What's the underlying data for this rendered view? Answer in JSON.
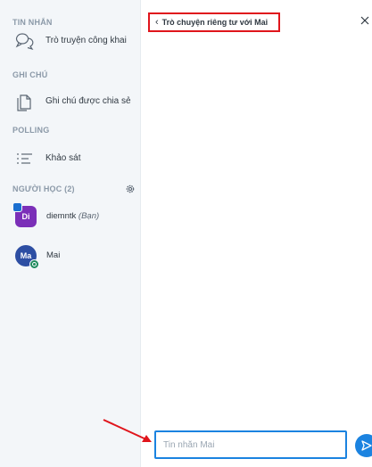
{
  "sidebar": {
    "messages_title": "TIN NHẮN",
    "public_chat_label": "Trò truyện công khai",
    "notes_title": "GHI CHÚ",
    "shared_notes_label": "Ghi chú được chia sẻ",
    "polling_title": "POLLING",
    "survey_label": "Khảo sát",
    "users_title": "NGƯỜI HỌC (2)",
    "users": [
      {
        "initials": "Di",
        "name": "diemntk",
        "suffix": "(Bạn)"
      },
      {
        "initials": "Ma",
        "name": "Mai",
        "suffix": ""
      }
    ]
  },
  "chat": {
    "header_title": "Trò chuyện riêng tư với Mai",
    "input_placeholder": "Tin nhắn Mai"
  },
  "colors": {
    "accent": "#1b83e0",
    "highlight": "#e0151c",
    "avatar_di": "#7b2fb8",
    "avatar_ma": "#2d4ea3",
    "online": "#1f8a5f"
  }
}
